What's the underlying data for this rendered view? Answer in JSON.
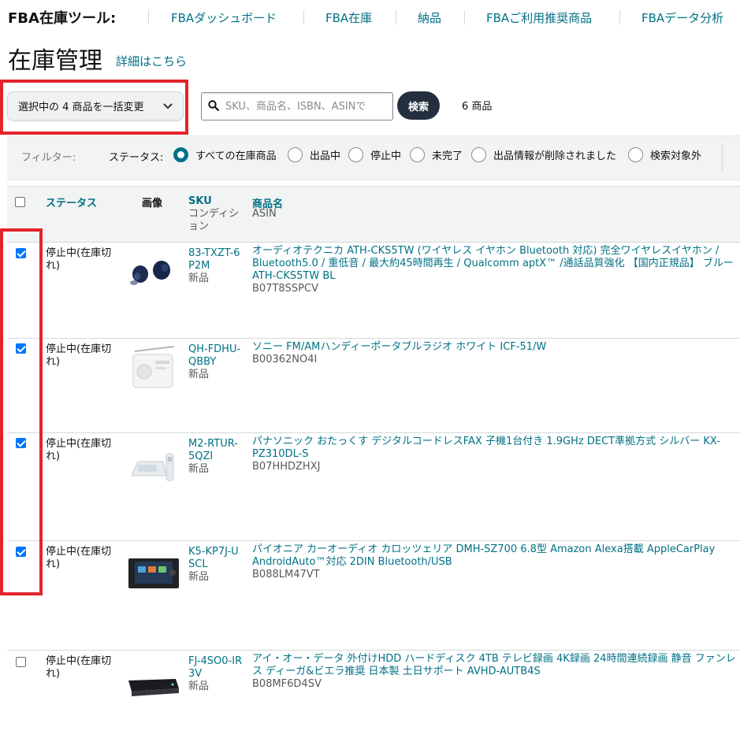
{
  "nav": {
    "brand": "FBA在庫ツール:",
    "items": [
      {
        "label": "FBAダッシュボード"
      },
      {
        "label": "FBA在庫"
      },
      {
        "label": "納品"
      },
      {
        "label": "FBAご利用推奨商品"
      },
      {
        "label": "FBAデータ分析"
      }
    ]
  },
  "page": {
    "title": "在庫管理",
    "detail_link": "詳細はこちら"
  },
  "toolbar": {
    "bulk_action_label": "選択中の 4 商品を一括変更",
    "search_placeholder": "SKU、商品名、ISBN、ASINで",
    "search_button": "検索",
    "item_count": "6 商品"
  },
  "filter": {
    "label": "フィルター:",
    "status_label": "ステータス:",
    "options": [
      {
        "label": "すべての在庫商品",
        "selected": true
      },
      {
        "label": "出品中",
        "selected": false
      },
      {
        "label": "停止中",
        "selected": false
      },
      {
        "label": "未完了",
        "selected": false
      },
      {
        "label": "出品情報が削除されました",
        "selected": false
      },
      {
        "label": "検索対象外",
        "selected": false
      }
    ]
  },
  "table": {
    "headers": {
      "status": "ステータス",
      "image": "画像",
      "sku": "SKU",
      "condition": "コンディション",
      "name": "商品名",
      "asin": "ASIN"
    },
    "rows": [
      {
        "checked": true,
        "status": "停止中(在庫切れ)",
        "sku": "83-TXZT-6P2M",
        "condition": "新品",
        "name": "オーディオテクニカ ATH-CKS5TW (ワイヤレス イヤホン Bluetooth 対応) 完全ワイヤレスイヤホン / Bluetooth5.0 / 重低音 / 最大約45時間再生 / Qualcomm aptX™ /通話品質強化 【国内正規品】 ブルー ATH-CKS5TW BL",
        "asin": "B07T8SSPCV",
        "thumb": "earbuds-image"
      },
      {
        "checked": true,
        "status": "停止中(在庫切れ)",
        "sku": "QH-FDHU-QBBY",
        "condition": "新品",
        "name": "ソニー FM/AMハンディーポータブルラジオ ホワイト ICF-51/W",
        "asin": "B00362NO4I",
        "thumb": "radio-image"
      },
      {
        "checked": true,
        "status": "停止中(在庫切れ)",
        "sku": "M2-RTUR-5QZI",
        "condition": "新品",
        "name": "パナソニック おたっくす デジタルコードレスFAX 子機1台付き 1.9GHz DECT準拠方式 シルバー KX-PZ310DL-S",
        "asin": "B07HHDZHXJ",
        "thumb": "fax-image"
      },
      {
        "checked": true,
        "status": "停止中(在庫切れ)",
        "sku": "K5-KP7J-USCL",
        "condition": "新品",
        "name": "パイオニア カーオーディオ カロッツェリア DMH-SZ700 6.8型 Amazon Alexa搭載 AppleCarPlay AndroidAuto™対応 2DIN Bluetooth/USB",
        "asin": "B088LM47VT",
        "thumb": "car-audio-image"
      },
      {
        "checked": false,
        "status": "停止中(在庫切れ)",
        "sku": "FJ-4SO0-IR3V",
        "condition": "新品",
        "name": "アイ・オー・データ 外付けHDD ハードディスク 4TB テレビ録画 4K録画 24時間連続録画 静音 ファンレス ディーガ&ビエラ推奨 日本製 土日サポート AVHD-AUTB4S",
        "asin": "B08MF6D4SV",
        "thumb": "hdd-image"
      }
    ]
  },
  "colors": {
    "link": "#007185",
    "highlight": "#e3242b",
    "checkbox": "#0075ff",
    "search_button": "#232f3e"
  }
}
